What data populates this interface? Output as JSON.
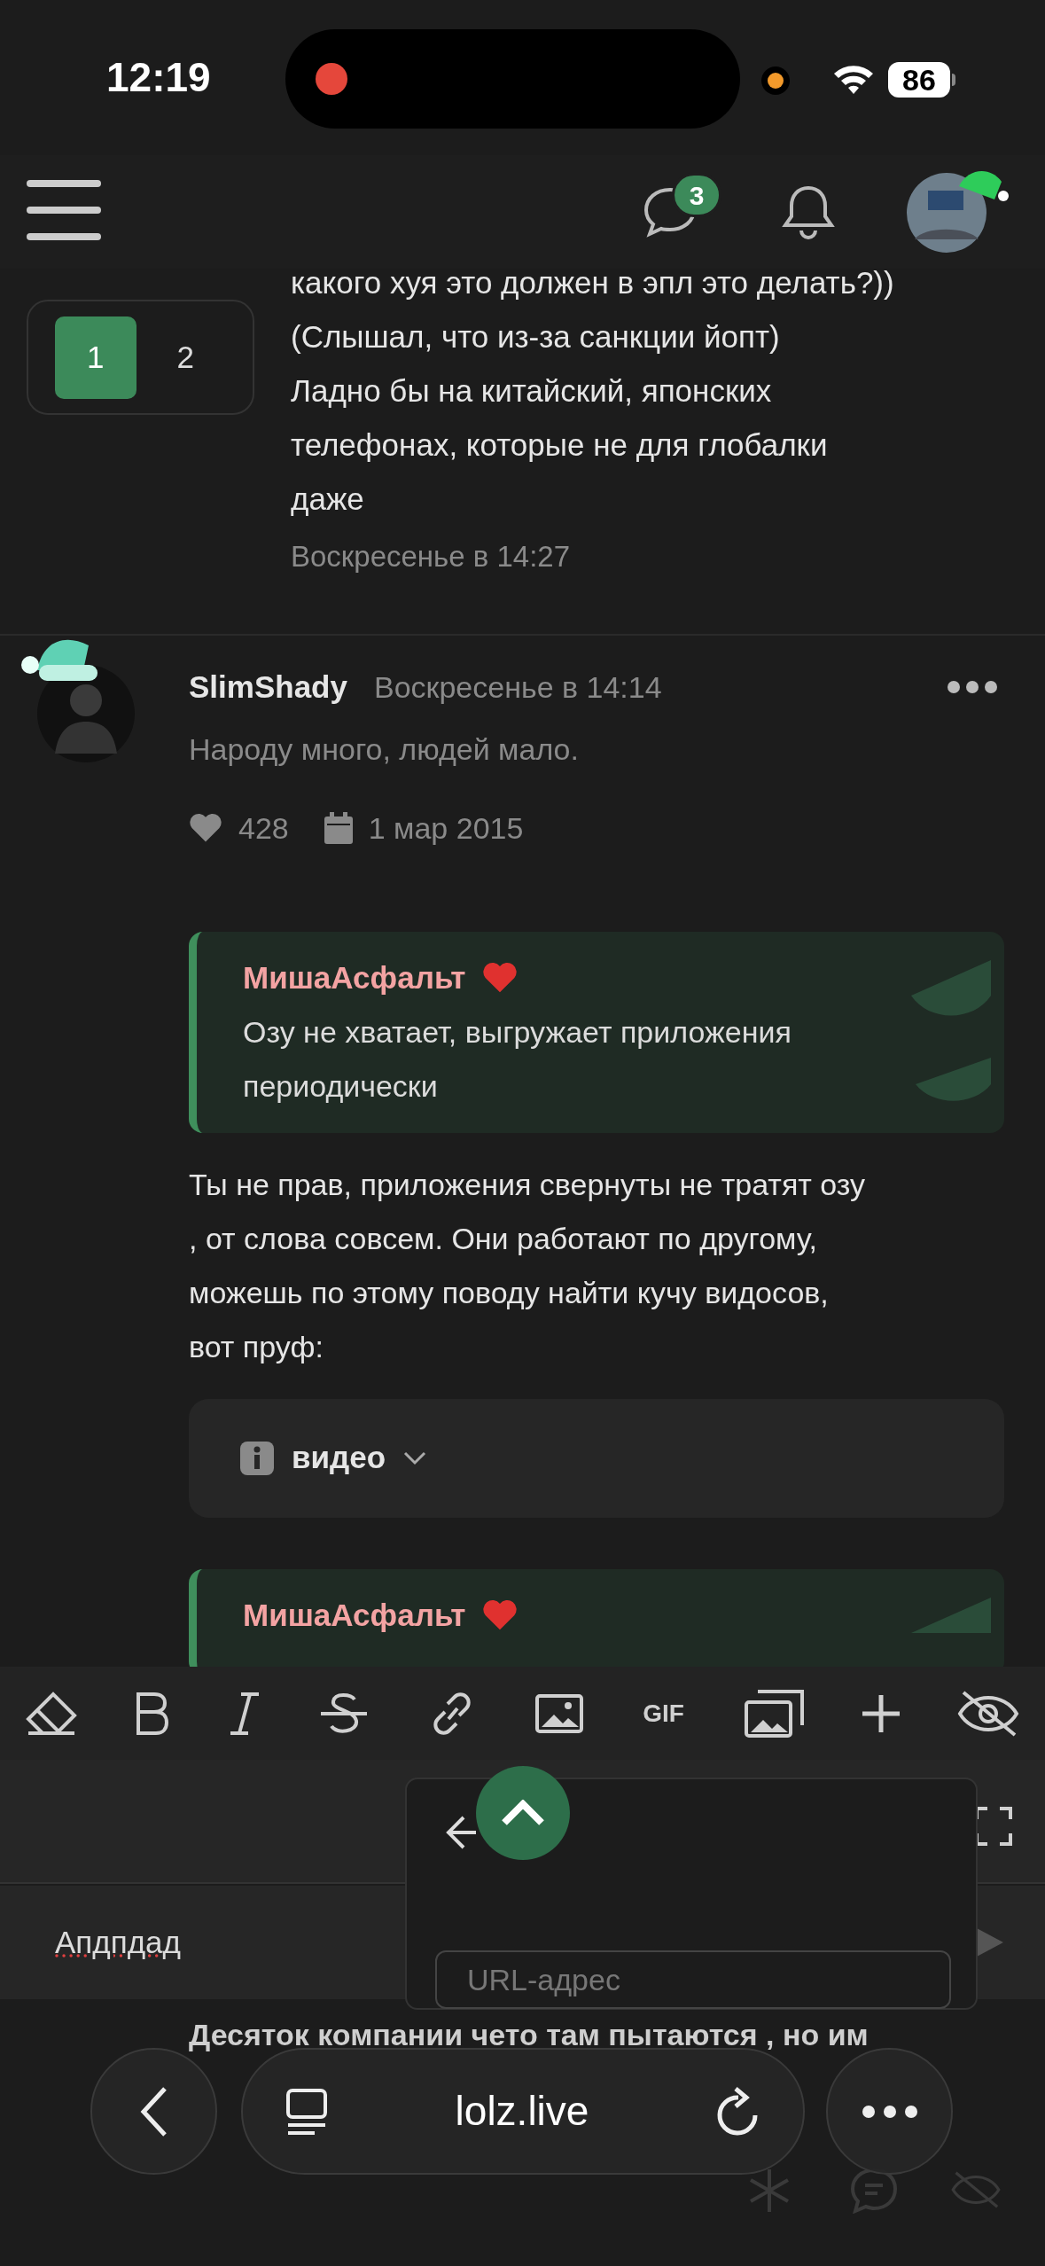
{
  "status_bar": {
    "time": "12:19",
    "battery": "86"
  },
  "header": {
    "messages_badge": "3"
  },
  "pagination": [
    {
      "label": "1",
      "selected": true
    },
    {
      "label": "2",
      "selected": false
    }
  ],
  "previous_post": {
    "text": "какого хуя это должен в эпл это делать?))\n(Слышал, что из-за санкции йопт)\nЛадно бы на китайский, японских\nтелефонах, которые не для глобалки\nдаже",
    "time": "Воскресенье в 14:27"
  },
  "post": {
    "author": "SlimShady",
    "time": "Воскресенье в 14:14",
    "status": "Народу много, людей мало.",
    "likes": "428",
    "joined": "1 мар 2015",
    "content": [
      {
        "kind": "quote",
        "author": "МишаАсфальт",
        "text": "Озу не хватает, выгружает приложения\nпериодически"
      },
      {
        "kind": "paragraph",
        "text": "Ты не прав, приложения свернуты не тратят озу\n, от слова совсем. Они работают по другому,\nможешь по этому поводу найти кучу видосов,\nвот пруф:"
      },
      {
        "kind": "spoiler",
        "title": "видео"
      },
      {
        "kind": "quote",
        "author": "МишаАсфальт"
      }
    ]
  },
  "editor": {
    "gif_label": "GIF",
    "text": "Апдпдад",
    "link_popup": {
      "placeholder": "URL-адрес"
    }
  },
  "page_below": {
    "text": "Десяток компании чето там пытаются , но им"
  },
  "browser_bar": {
    "url": "lolz.live"
  }
}
